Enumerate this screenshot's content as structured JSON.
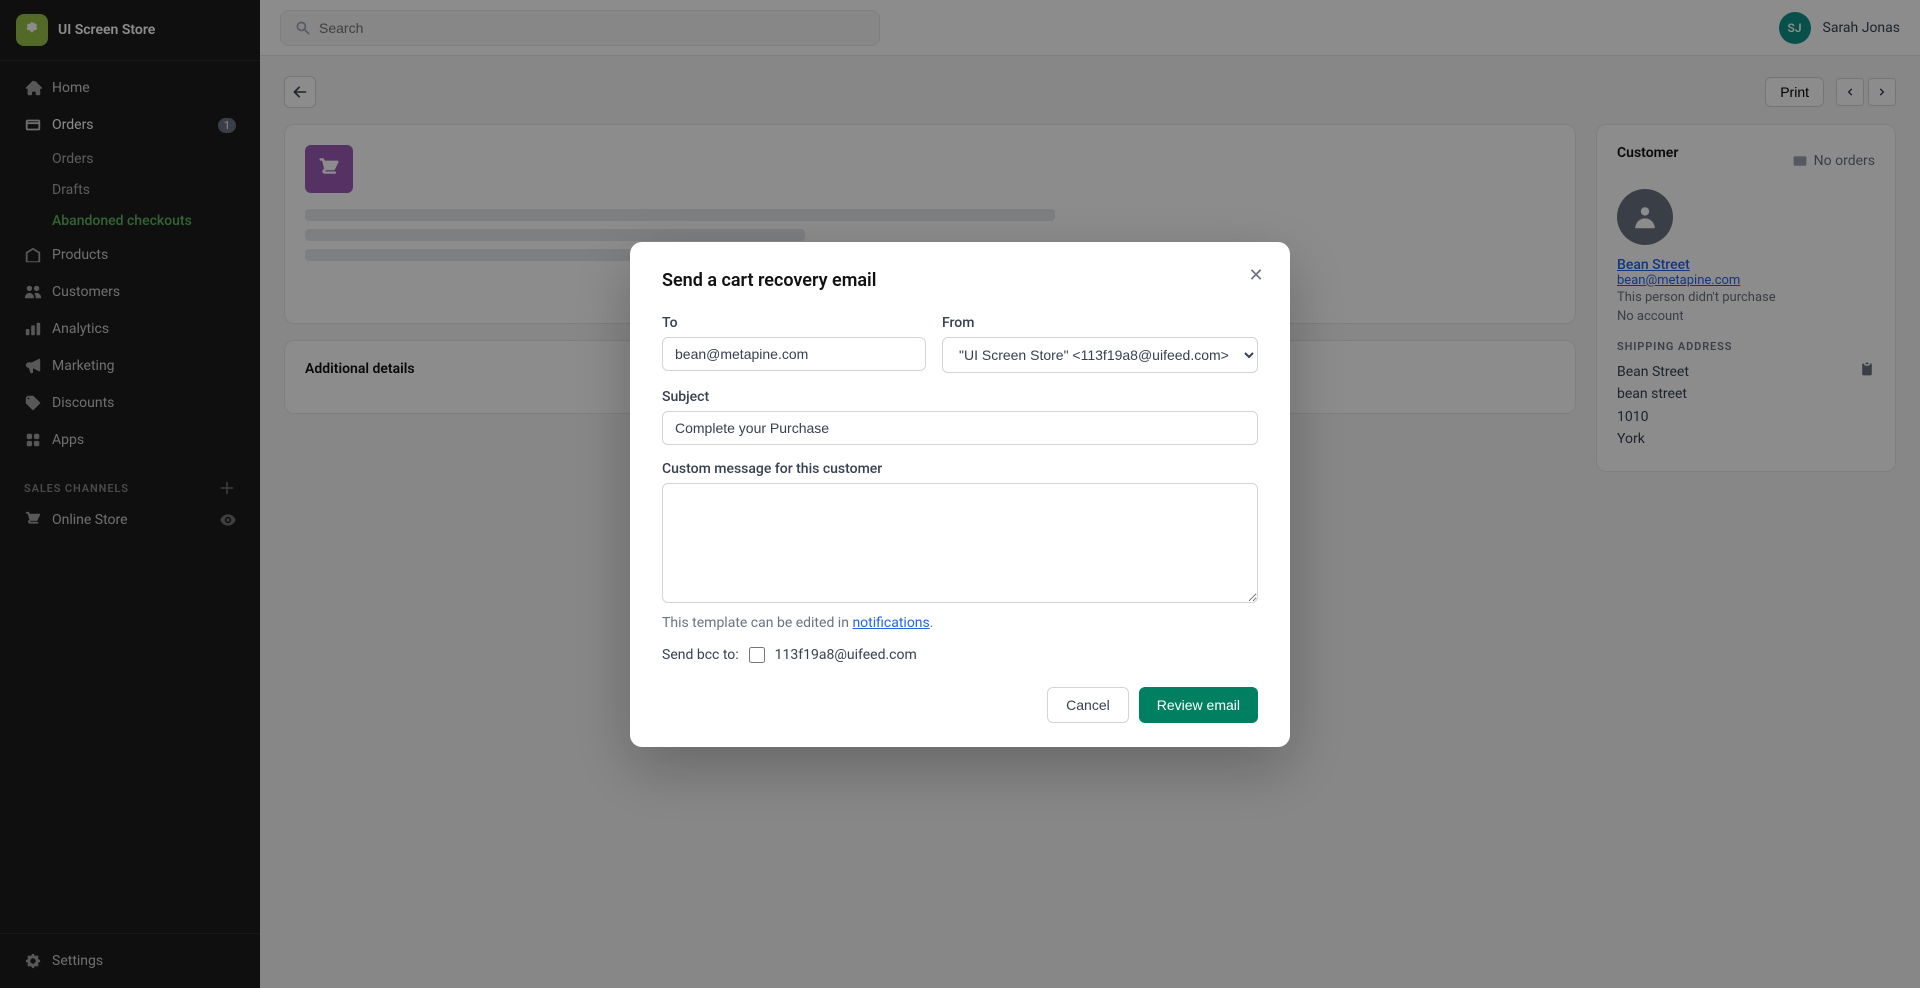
{
  "sidebar": {
    "logo": "🛍",
    "store_name": "UI Screen Store",
    "nav_items": [
      {
        "id": "home",
        "label": "Home",
        "icon": "home"
      },
      {
        "id": "orders",
        "label": "Orders",
        "icon": "orders",
        "badge": "1"
      },
      {
        "id": "products",
        "label": "Products",
        "icon": "products"
      },
      {
        "id": "customers",
        "label": "Customers",
        "icon": "customers"
      },
      {
        "id": "analytics",
        "label": "Analytics",
        "icon": "analytics"
      },
      {
        "id": "marketing",
        "label": "Marketing",
        "icon": "marketing"
      },
      {
        "id": "discounts",
        "label": "Discounts",
        "icon": "discounts"
      },
      {
        "id": "apps",
        "label": "Apps",
        "icon": "apps"
      }
    ],
    "sub_nav": [
      {
        "id": "orders-list",
        "label": "Orders",
        "active": false
      },
      {
        "id": "drafts",
        "label": "Drafts",
        "active": false
      },
      {
        "id": "abandoned",
        "label": "Abandoned checkouts",
        "active": true
      }
    ],
    "sales_channels_label": "SALES CHANNELS",
    "sales_channels": [
      {
        "id": "online-store",
        "label": "Online Store",
        "icon": "store"
      }
    ],
    "footer": [
      {
        "id": "settings",
        "label": "Settings",
        "icon": "settings"
      }
    ]
  },
  "topbar": {
    "search_placeholder": "Search",
    "user_initials": "SJ",
    "user_name": "Sarah Jonas"
  },
  "toolbar": {
    "print_label": "Print"
  },
  "customer_panel": {
    "title": "Customer",
    "no_orders_label": "No orders",
    "customer_name": "Bean Street",
    "customer_email": "bean@metapine.com",
    "customer_note": "This person didn't purchase",
    "account_status": "No account",
    "shipping_title": "SHIPPING ADDRESS",
    "address": {
      "name": "Bean Street",
      "street": "bean street",
      "number": "1010",
      "city": "York"
    }
  },
  "additional_details_label": "Additional details",
  "modal": {
    "title": "Send a cart recovery email",
    "to_label": "To",
    "to_value": "bean@metapine.com",
    "from_label": "From",
    "from_value": "\"UI Screen Store\" <113f19a8@uifeed.com>",
    "subject_label": "Subject",
    "subject_value": "Complete your Purchase",
    "custom_message_label": "Custom message for this customer",
    "custom_message_placeholder": "",
    "template_note": "This template can be edited in",
    "notifications_link": "notifications",
    "template_note_end": ".",
    "bcc_label": "Send bcc to:",
    "bcc_email": "113f19a8@uifeed.com",
    "bcc_checked": false,
    "cancel_label": "Cancel",
    "review_label": "Review email"
  }
}
